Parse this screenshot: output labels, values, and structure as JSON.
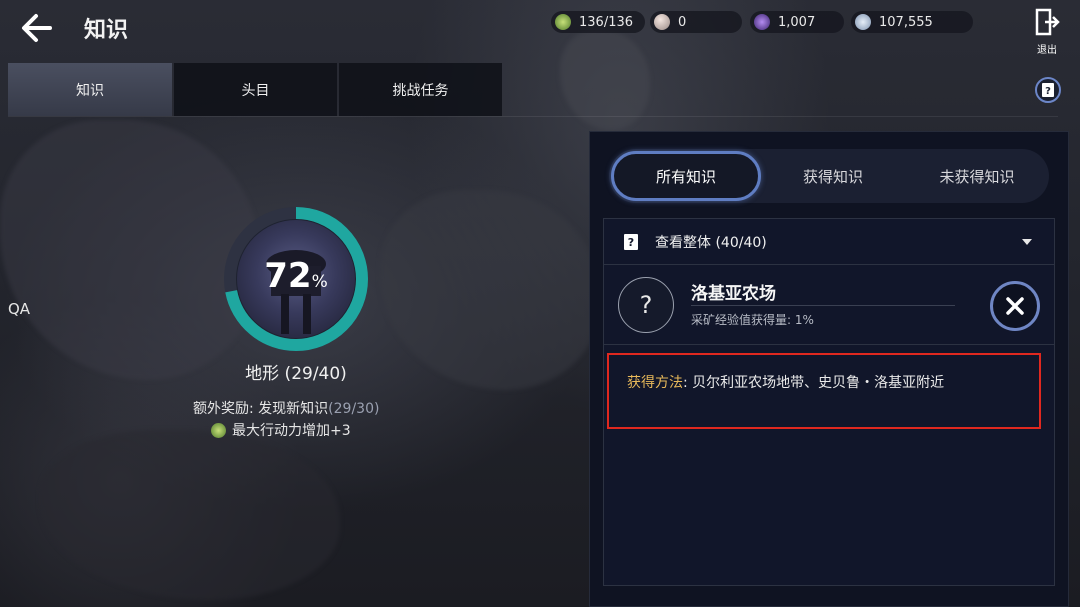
{
  "header": {
    "title": "知识",
    "exit_label": "退出"
  },
  "currencies": [
    {
      "icon": "energy-icon",
      "value": "136/136"
    },
    {
      "icon": "pearl-icon",
      "value": "0"
    },
    {
      "icon": "crystal-icon",
      "value": "1,007"
    },
    {
      "icon": "silver-icon",
      "value": "107,555"
    }
  ],
  "tabs": [
    {
      "label": "知识",
      "active": true
    },
    {
      "label": "头目",
      "active": false
    },
    {
      "label": "挑战任务",
      "active": false
    }
  ],
  "sidebar": {
    "qa_label": "QA"
  },
  "progress": {
    "percent": 72,
    "percent_value": "72",
    "percent_sign": "%",
    "ring_color": "#1fa7a0",
    "category_label": "地形 (29/40)",
    "bonus_label": "额外奖励: 发现新知识",
    "bonus_count": "(29/30)",
    "reward_text": "最大行动力增加+3"
  },
  "panel": {
    "filters": [
      {
        "label": "所有知识",
        "active": true
      },
      {
        "label": "获得知识",
        "active": false
      },
      {
        "label": "未获得知识",
        "active": false
      }
    ],
    "dropdown_label": "查看整体 (40/40)",
    "entry": {
      "icon_text": "?",
      "name": "洛基亚农场",
      "description": "采矿经验值获得量: 1%"
    },
    "method": {
      "label": "获得方法",
      "text": ": 贝尔利亚农场地带、史贝鲁・洛基亚附近"
    },
    "highlight_color": "#e0281f"
  }
}
